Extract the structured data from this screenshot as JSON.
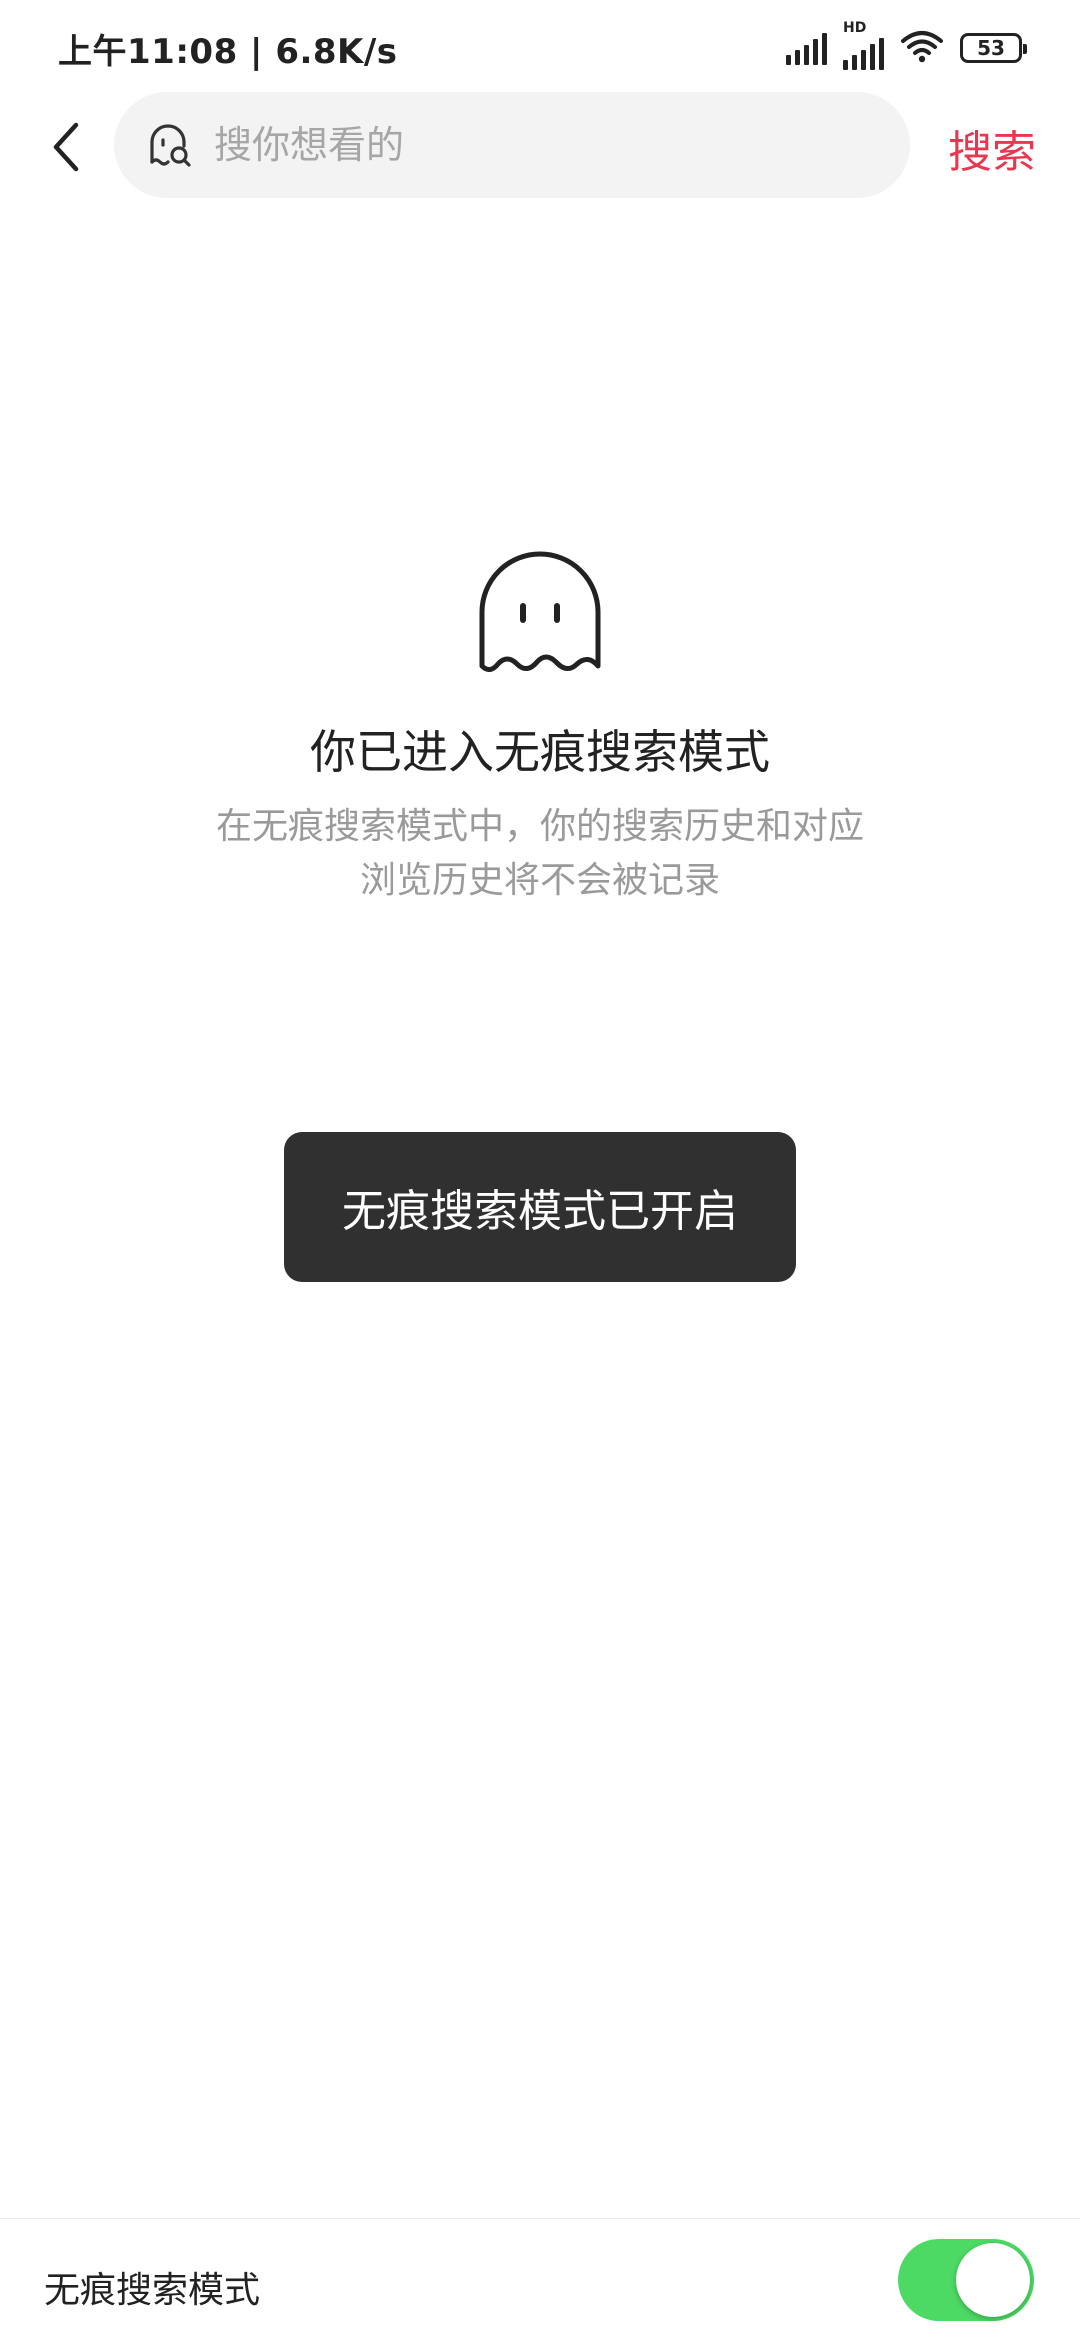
{
  "status_bar": {
    "time_speed": "上午11:08 | 6.8K/s",
    "hd_label": "HD",
    "battery_level": "53"
  },
  "header": {
    "search_placeholder": "搜你想看的",
    "search_button": "搜索"
  },
  "empty_state": {
    "title": "你已进入无痕搜索模式",
    "description_line1": "在无痕搜索模式中，你的搜索历史和对应",
    "description_line2": "浏览历史将不会被记录"
  },
  "toast": {
    "message": "无痕搜索模式已开启"
  },
  "bottom_bar": {
    "label": "无痕搜索模式",
    "toggle_on": true
  },
  "colors": {
    "accent_red": "#e8384f",
    "toggle_green": "#4cd964",
    "toast_bg": "#303030"
  },
  "icons": {
    "back": "chevron-left-icon",
    "search": "ghost-search-icon",
    "ghost": "ghost-icon"
  }
}
